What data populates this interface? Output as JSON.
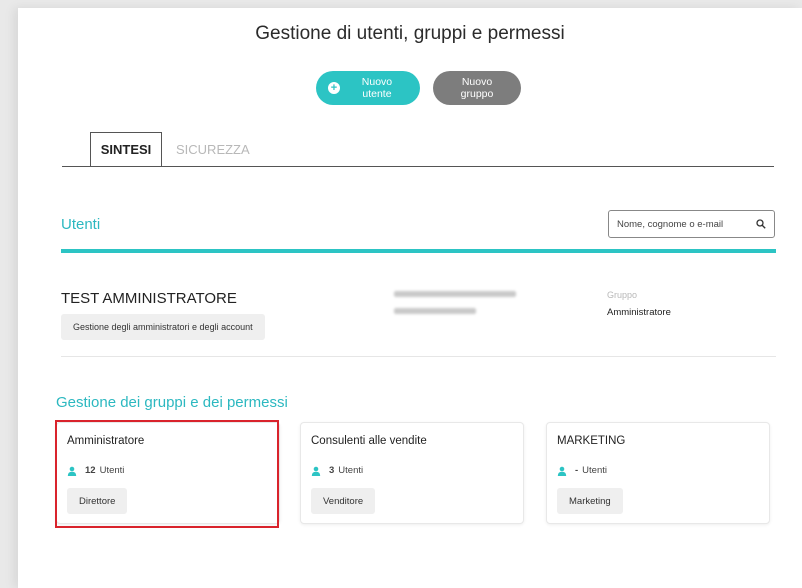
{
  "page": {
    "title": "Gestione di utenti, gruppi e permessi"
  },
  "actions": {
    "new_user": "Nuovo utente",
    "new_group": "Nuovo gruppo"
  },
  "tabs": [
    {
      "label": "SINTESI"
    },
    {
      "label": "SICUREZZA"
    }
  ],
  "users_section": {
    "title": "Utenti",
    "search_placeholder": "Nome, cognome o e-mail",
    "user": {
      "name": "TEST AMMINISTRATORE",
      "tag": "Gestione degli amministratori e degli account",
      "group_label": "Gruppo",
      "group_value": "Amministratore"
    }
  },
  "groups_section": {
    "title": "Gestione dei gruppi e dei permessi",
    "cards": [
      {
        "name": "Amministratore",
        "count": "12",
        "count_label": "Utenti",
        "role": "Direttore"
      },
      {
        "name": "Consulenti alle vendite",
        "count": "3",
        "count_label": "Utenti",
        "role": "Venditore"
      },
      {
        "name": "MARKETING",
        "count": "-",
        "count_label": "Utenti",
        "role": "Marketing"
      }
    ]
  },
  "colors": {
    "accent": "#2cc4c4",
    "secondary_button": "#7d7d7d",
    "highlight": "#d9232c"
  }
}
